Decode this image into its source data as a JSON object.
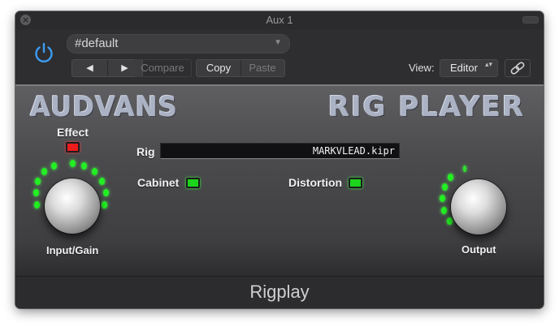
{
  "window": {
    "title": "Aux 1",
    "footer_label": "Rigplay"
  },
  "header": {
    "preset_name": "#default",
    "prev_glyph": "◀",
    "next_glyph": "▶",
    "compare_label": "Compare",
    "copy_label": "Copy",
    "paste_label": "Paste",
    "view_label": "View:",
    "view_value": "Editor",
    "close_glyph": "×",
    "preset_arrow": "▼",
    "view_arrow": "▴▾"
  },
  "plugin": {
    "brand": "AUDVANS",
    "product": "RIG PLAYER",
    "effect_label": "Effect",
    "effect_led": "red",
    "rig_label": "Rig",
    "rig_value": "MARKVLEAD.kipr",
    "cabinet_label": "Cabinet",
    "cabinet_led": "green",
    "distortion_label": "Distortion",
    "distortion_led": "green",
    "input_gain_label": "Input/Gain",
    "output_label": "Output"
  },
  "colors": {
    "accent_blue": "#3b9cf2",
    "led_green": "#1bd41b",
    "led_red": "#ee1c1c",
    "panel": "#4a4a4d"
  },
  "icons": {
    "power": "power-icon",
    "link": "link-icon",
    "close": "close-icon"
  }
}
